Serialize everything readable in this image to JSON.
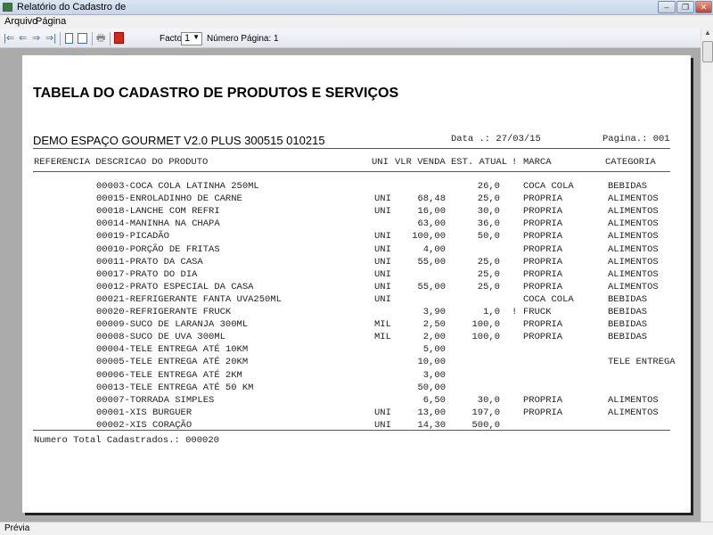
{
  "window": {
    "title": "Relatório do Cadastro de"
  },
  "menu": [
    "Arquivo",
    "Página"
  ],
  "toolbar": {
    "factor_label": "Factor:",
    "factor_value": "1",
    "page_label": "Número Página: 1"
  },
  "report": {
    "title": "TABELA DO CADASTRO DE PRODUTOS E SERVIÇOS",
    "company": "DEMO ESPAÇO GOURMET V2.0 PLUS 300515 010215",
    "date": "Data .: 27/03/15",
    "page": "Pagina.: 001",
    "headers": {
      "ref": "REFERENCIA DESCRICAO DO PRODUTO",
      "uni": "UNI",
      "vlr": "VLR VENDA",
      "est": "EST. ATUAL",
      "flag": "!",
      "marca": "MARCA",
      "cat": "CATEGORIA"
    },
    "rows": [
      {
        "desc": "00003-COCA COLA LATINHA 250ML",
        "uni": "",
        "vlr": "",
        "est": "26,0",
        "flag": "",
        "marca": "COCA COLA",
        "cat": "BEBIDAS"
      },
      {
        "desc": "00015-ENROLADINHO DE CARNE",
        "uni": "UNI",
        "vlr": "68,48",
        "est": "25,0",
        "flag": "",
        "marca": "PROPRIA",
        "cat": "ALIMENTOS"
      },
      {
        "desc": "00018-LANCHE COM REFRI",
        "uni": "UNI",
        "vlr": "16,00",
        "est": "30,0",
        "flag": "",
        "marca": "PROPRIA",
        "cat": "ALIMENTOS"
      },
      {
        "desc": "00014-MANINHA NA CHAPA",
        "uni": "",
        "vlr": "63,00",
        "est": "36,0",
        "flag": "",
        "marca": "PROPRIA",
        "cat": "ALIMENTOS"
      },
      {
        "desc": "00019-PICADÃO",
        "uni": "UNI",
        "vlr": "100,00",
        "est": "50,0",
        "flag": "",
        "marca": "PROPRIA",
        "cat": "ALIMENTOS"
      },
      {
        "desc": "00010-PORÇÃO DE FRITAS",
        "uni": "UNI",
        "vlr": "4,00",
        "est": "",
        "flag": "",
        "marca": "PROPRIA",
        "cat": "ALIMENTOS"
      },
      {
        "desc": "00011-PRATO DA CASA",
        "uni": "UNI",
        "vlr": "55,00",
        "est": "25,0",
        "flag": "",
        "marca": "PROPRIA",
        "cat": "ALIMENTOS"
      },
      {
        "desc": "00017-PRATO DO DIA",
        "uni": "UNI",
        "vlr": "",
        "est": "25,0",
        "flag": "",
        "marca": "PROPRIA",
        "cat": "ALIMENTOS"
      },
      {
        "desc": "00012-PRATO ESPECIAL DA CASA",
        "uni": "UNI",
        "vlr": "55,00",
        "est": "25,0",
        "flag": "",
        "marca": "PROPRIA",
        "cat": "ALIMENTOS"
      },
      {
        "desc": "00021-REFRIGERANTE FANTA UVA250ML",
        "uni": "UNI",
        "vlr": "",
        "est": "",
        "flag": "",
        "marca": "COCA COLA",
        "cat": "BEBIDAS"
      },
      {
        "desc": "00020-REFRIGERANTE FRUCK",
        "uni": "",
        "vlr": "3,90",
        "est": "1,0",
        "flag": "!",
        "marca": "FRUCK",
        "cat": "BEBIDAS"
      },
      {
        "desc": "00009-SUCO DE LARANJA 300ML",
        "uni": "MIL",
        "vlr": "2,50",
        "est": "100,0",
        "flag": "",
        "marca": "PROPRIA",
        "cat": "BEBIDAS"
      },
      {
        "desc": "00008-SUCO DE UVA 300ML",
        "uni": "MIL",
        "vlr": "2,00",
        "est": "100,0",
        "flag": "",
        "marca": "PROPRIA",
        "cat": "BEBIDAS"
      },
      {
        "desc": "00004-TELE ENTREGA ATÉ 10KM",
        "uni": "",
        "vlr": "5,00",
        "est": "",
        "flag": "",
        "marca": "",
        "cat": ""
      },
      {
        "desc": "00005-TELE ENTREGA ATÉ 20KM",
        "uni": "",
        "vlr": "10,00",
        "est": "",
        "flag": "",
        "marca": "",
        "cat": "TELE ENTREGA"
      },
      {
        "desc": "00006-TELE ENTREGA ATÉ 2KM",
        "uni": "",
        "vlr": "3,00",
        "est": "",
        "flag": "",
        "marca": "",
        "cat": ""
      },
      {
        "desc": "00013-TELE ENTREGA ATÉ 50 KM",
        "uni": "",
        "vlr": "50,00",
        "est": "",
        "flag": "",
        "marca": "",
        "cat": ""
      },
      {
        "desc": "00007-TORRADA SIMPLES",
        "uni": "",
        "vlr": "6,50",
        "est": "30,0",
        "flag": "",
        "marca": "PROPRIA",
        "cat": "ALIMENTOS"
      },
      {
        "desc": "00001-XIS BURGUER",
        "uni": "UNI",
        "vlr": "13,00",
        "est": "197,0",
        "flag": "",
        "marca": "PROPRIA",
        "cat": "ALIMENTOS"
      },
      {
        "desc": "00002-XIS CORAÇÃO",
        "uni": "UNI",
        "vlr": "14,30",
        "est": "500,0",
        "flag": "",
        "marca": "",
        "cat": ""
      }
    ],
    "total": "Numero Total Cadastrados.: 000020"
  },
  "status": "Prévia"
}
